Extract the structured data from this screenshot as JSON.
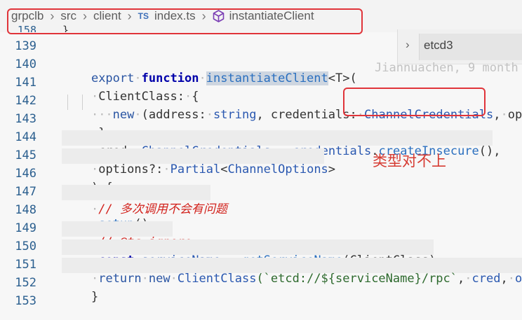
{
  "breadcrumb": {
    "items": [
      "grpclb",
      "src",
      "client",
      "index.ts",
      "instantiateClient"
    ],
    "ts_badge": "TS",
    "separator": "›"
  },
  "peek": {
    "label": "etcd3"
  },
  "blame": "Jiannuachen, 9 month",
  "annotation": "类型对不上",
  "partial_top_line": "158",
  "lines": [
    {
      "num": "139"
    },
    {
      "num": "140",
      "tokens": [
        "export",
        "function",
        "instantiateClient",
        "<T>("
      ]
    },
    {
      "num": "141",
      "tokens": [
        "ClientClass",
        ":",
        "{"
      ]
    },
    {
      "num": "142",
      "tokens": [
        "new",
        "(address",
        ":",
        "string",
        ", credentials",
        ":",
        "ChannelCredentials",
        ",",
        "opti"
      ]
    },
    {
      "num": "143",
      "tokens": [
        "},"
      ]
    },
    {
      "num": "144",
      "tokens": [
        "cred",
        ":",
        "ChannelCredentials",
        "=",
        "credentials",
        ".",
        "createInsecure",
        "(),"
      ]
    },
    {
      "num": "145",
      "tokens": [
        "options",
        "?:",
        "Partial",
        "<",
        "ChannelOptions",
        ">"
      ]
    },
    {
      "num": "146",
      "tokens": [
        ") {"
      ]
    },
    {
      "num": "147",
      "tokens": [
        "// 多次调用不会有问题"
      ]
    },
    {
      "num": "148",
      "tokens": [
        "setup",
        "();"
      ]
    },
    {
      "num": "149",
      "tokens": [
        "// @ts-ignore"
      ]
    },
    {
      "num": "150",
      "tokens": [
        "const",
        "serviceName",
        "=",
        "getServiceName",
        "(ClientClass);"
      ]
    },
    {
      "num": "151",
      "tokens": [
        "return",
        "new",
        "ClientClass",
        "(`etcd://${serviceName}/rpc`",
        ",",
        "cred",
        ",",
        "opt"
      ]
    },
    {
      "num": "152",
      "tokens": [
        "}"
      ]
    },
    {
      "num": "153"
    }
  ],
  "colors": {
    "annotation_red": "#e0343a",
    "keyword": "#0000aa",
    "type": "#2a58b0",
    "comment": "#d2221c",
    "line_number": "#2b5f8f"
  }
}
